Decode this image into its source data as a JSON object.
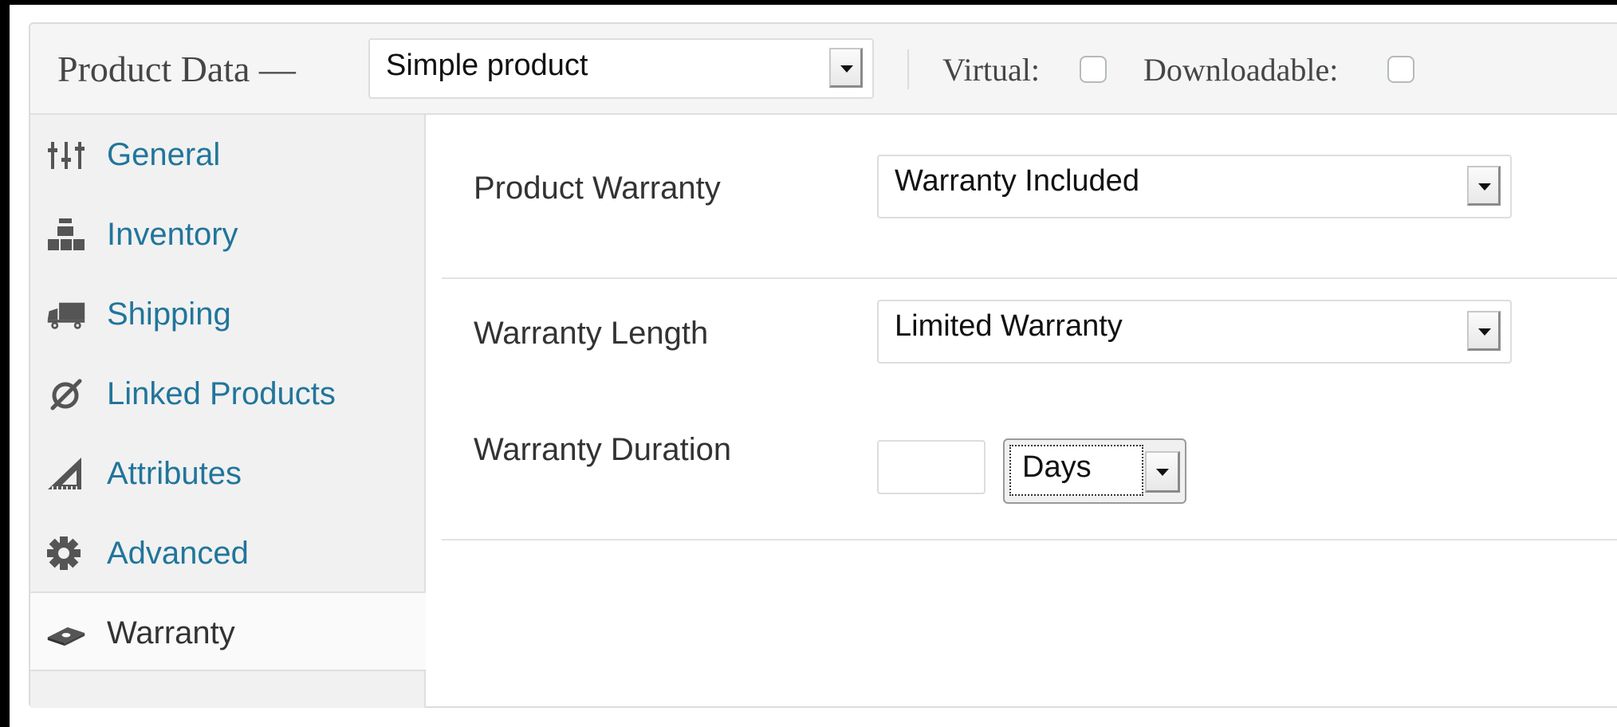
{
  "header": {
    "title": "Product Data —",
    "product_type": "Simple product",
    "virtual_label": "Virtual:",
    "virtual_checked": false,
    "downloadable_label": "Downloadable:",
    "downloadable_checked": false
  },
  "sidebar": {
    "items": [
      {
        "label": "General",
        "icon": "sliders-icon"
      },
      {
        "label": "Inventory",
        "icon": "boxes-icon"
      },
      {
        "label": "Shipping",
        "icon": "truck-icon"
      },
      {
        "label": "Linked Products",
        "icon": "link-icon"
      },
      {
        "label": "Attributes",
        "icon": "ruler-triangle-icon"
      },
      {
        "label": "Advanced",
        "icon": "gear-icon"
      },
      {
        "label": "Warranty",
        "icon": "ticket-icon",
        "active": true
      }
    ]
  },
  "warranty": {
    "product_warranty_label": "Product Warranty",
    "product_warranty_value": "Warranty Included",
    "length_label": "Warranty Length",
    "length_value": "Limited Warranty",
    "duration_label": "Warranty Duration",
    "duration_value": "",
    "duration_unit": "Days"
  },
  "colors": {
    "link": "#21759b",
    "active_text": "#333333",
    "sidebar_bg": "#f1f1f1",
    "header_bg": "#f5f5f5"
  }
}
